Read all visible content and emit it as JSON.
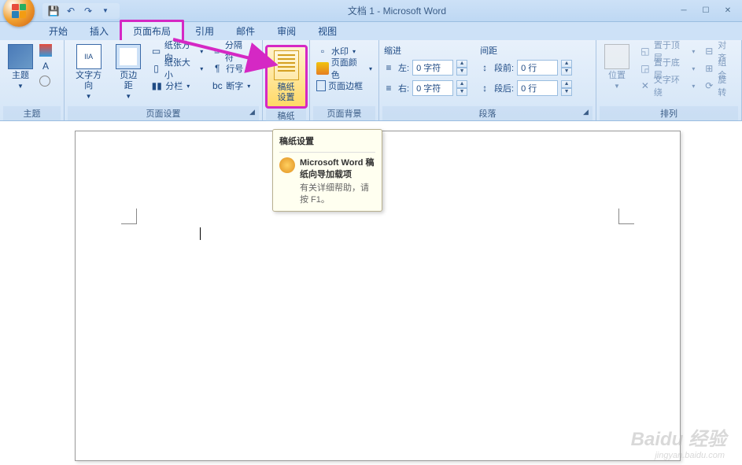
{
  "title": "文档 1 - Microsoft Word",
  "tabs": {
    "home": "开始",
    "insert": "插入",
    "page_layout": "页面布局",
    "references": "引用",
    "mailings": "邮件",
    "review": "审阅",
    "view": "视图"
  },
  "groups": {
    "themes": {
      "label": "主题",
      "theme": "主题"
    },
    "page_setup": {
      "label": "页面设置",
      "text_direction": "文字方向",
      "margins": "页边距",
      "orientation": "纸张方向",
      "size": "纸张大小",
      "columns": "分栏",
      "breaks": "分隔符",
      "line_numbers": "行号",
      "hyphenation": "断字"
    },
    "manuscript": {
      "label": "稿纸",
      "settings": "稿纸\n设置"
    },
    "page_bg": {
      "label": "页面背景",
      "watermark": "水印",
      "page_color": "页面颜色",
      "page_borders": "页面边框"
    },
    "paragraph": {
      "label": "段落",
      "indent": "缩进",
      "spacing": "间距",
      "left": "左:",
      "right": "右:",
      "before": "段前:",
      "after": "段后:",
      "left_val": "0 字符",
      "right_val": "0 字符",
      "before_val": "0 行",
      "after_val": "0 行"
    },
    "arrange": {
      "label": "排列",
      "position": "位置",
      "bring_front": "置于顶层",
      "send_back": "置于底层",
      "text_wrap": "文字环绕",
      "align": "对齐",
      "group": "组合",
      "rotate": "旋转"
    }
  },
  "tooltip": {
    "title": "稿纸设置",
    "heading": "Microsoft Word 稿纸向导加载项",
    "help": "有关详细帮助，请按 F1。"
  },
  "watermark": {
    "main": "Baidu 经验",
    "sub": "jingyan.baidu.com"
  }
}
